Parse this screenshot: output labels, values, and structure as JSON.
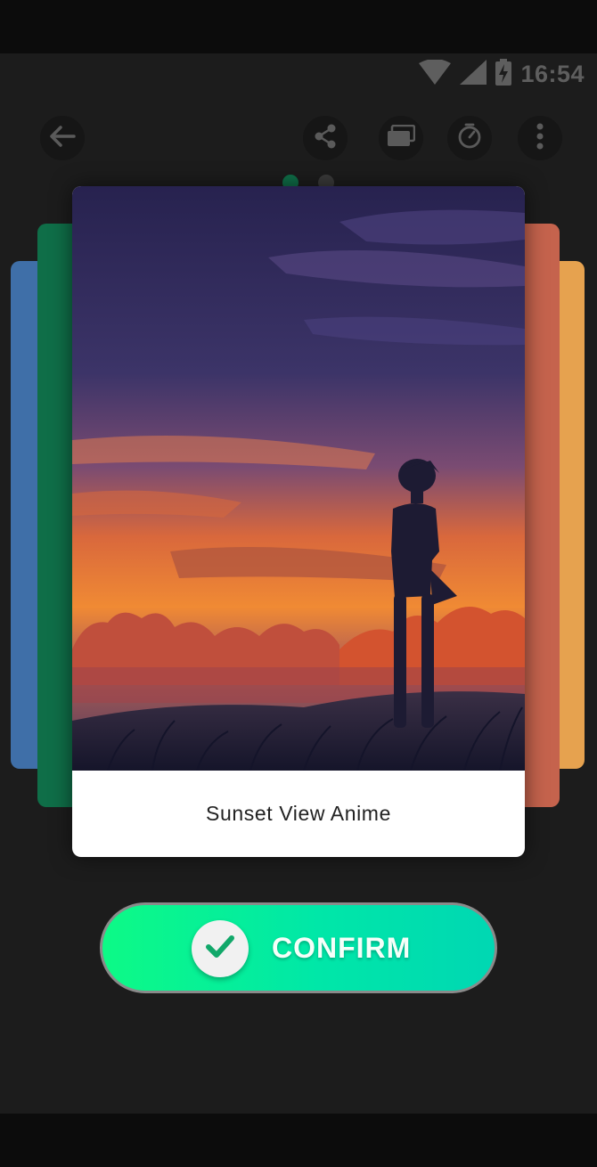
{
  "status_bar": {
    "time": "16:54",
    "icons": [
      "wifi-icon",
      "signal-icon",
      "battery-charging-icon"
    ]
  },
  "toolbar": {
    "buttons": [
      "back-arrow-icon",
      "share-icon",
      "layers-icon",
      "timer-icon",
      "more-vertical-icon"
    ]
  },
  "page_indicator": {
    "count": 2,
    "active_index": 0
  },
  "carousel": {
    "main_card": {
      "caption": "Sunset View Anime",
      "image": "sunset-anime-silhouette-wallpaper"
    },
    "side_cards": [
      {
        "side": "left",
        "color": "#3f6fa8"
      },
      {
        "side": "left",
        "color": "#0f6e48"
      },
      {
        "side": "right",
        "color": "#c5634d"
      },
      {
        "side": "right",
        "color": "#e6a24f"
      }
    ]
  },
  "confirm_button": {
    "label": "CONFIRM",
    "icon": "check-icon"
  },
  "colors": {
    "background": "#1c1c1c",
    "accent_gradient_start": "#0dfa86",
    "accent_gradient_end": "#00d7b3",
    "check": "#11a86a"
  }
}
